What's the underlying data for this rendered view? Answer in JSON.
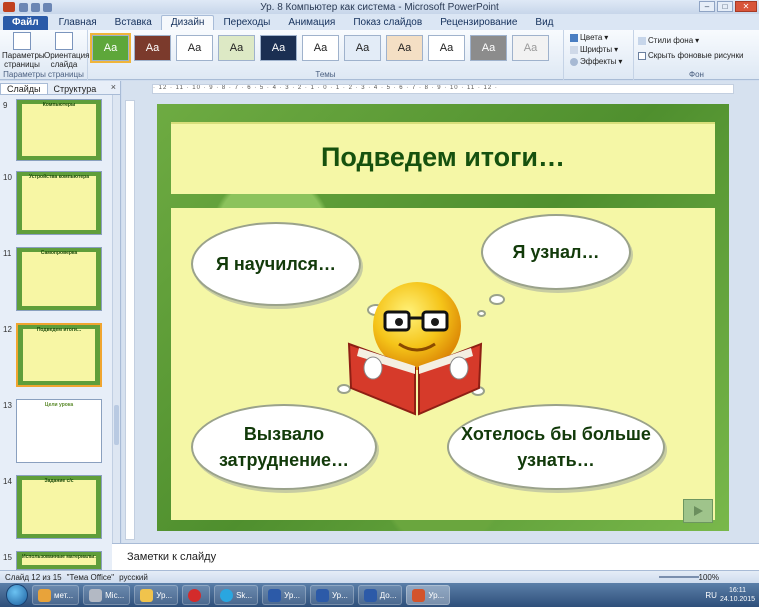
{
  "window": {
    "title": "Ур. 8 Компьютер как система - Microsoft PowerPoint"
  },
  "ribbon_tabs": [
    {
      "label": "Файл",
      "kind": "file"
    },
    {
      "label": "Главная"
    },
    {
      "label": "Вставка"
    },
    {
      "label": "Дизайн",
      "active": true
    },
    {
      "label": "Переходы"
    },
    {
      "label": "Анимация"
    },
    {
      "label": "Показ слайдов"
    },
    {
      "label": "Рецензирование"
    },
    {
      "label": "Вид"
    }
  ],
  "ribbon": {
    "page_setup_group": {
      "label": "Параметры страницы",
      "page_params": "Параметры страницы",
      "orientation": "Ориентация слайда"
    },
    "themes_group": {
      "label": "Темы",
      "theme_sample": "Aa"
    },
    "theme_options": {
      "colors": "Цвета",
      "fonts": "Шрифты",
      "effects": "Эффекты"
    },
    "background_group": {
      "label": "Фон",
      "styles": "Стили фона",
      "hide_graphics": "Скрыть фоновые рисунки"
    }
  },
  "left_panel": {
    "tab_slides": "Слайды",
    "tab_outline": "Структура",
    "close": "×",
    "thumbnails": [
      {
        "number": "9",
        "title": "Компьютеры"
      },
      {
        "number": "10",
        "title": "Устройства компьютера"
      },
      {
        "number": "11",
        "title": "Самопроверка"
      },
      {
        "number": "12",
        "title": "Подведем итоги...",
        "current": true
      },
      {
        "number": "13",
        "title": "Цели урока"
      },
      {
        "number": "14",
        "title": "Задание с/с"
      },
      {
        "number": "15",
        "title": "Использованные материалы:"
      }
    ]
  },
  "slide": {
    "title": "Подведем итоги…",
    "clouds": {
      "top_left": "Я научился…",
      "top_right": "Я узнал…",
      "bottom_left": "Вызвало затруднение…",
      "bottom_right": "Хотелось бы больше узнать…"
    }
  },
  "notes": {
    "placeholder": "Заметки к слайду"
  },
  "status_bar": {
    "slide_info": "Слайд 12 из 15",
    "theme": "\"Тема Office\"",
    "language": "русский",
    "zoom": "100%"
  },
  "taskbar": {
    "items": [
      {
        "label": "мет...",
        "color": "#e8a33a"
      },
      {
        "label": "Mic...",
        "color": "#b3b9c4"
      },
      {
        "label": "Ур...",
        "color": "#f0c34c"
      },
      {
        "label": "",
        "color": "#d32b2b"
      },
      {
        "label": "Sk...",
        "color": "#2aa6e0"
      },
      {
        "label": "Ур...",
        "color": "#2c5aa8"
      },
      {
        "label": "Ур...",
        "color": "#2c5aa8"
      },
      {
        "label": "До...",
        "color": "#2c5aa8"
      },
      {
        "label": "Ур...",
        "color": "#d2542c",
        "active": true
      }
    ],
    "tray_lang": "RU",
    "time": "16:11",
    "date": "24.10.2015"
  },
  "colors": {
    "slide_green": "#5f9e3a",
    "band_yellow": "#f5f7a6",
    "title_green": "#16510e"
  }
}
